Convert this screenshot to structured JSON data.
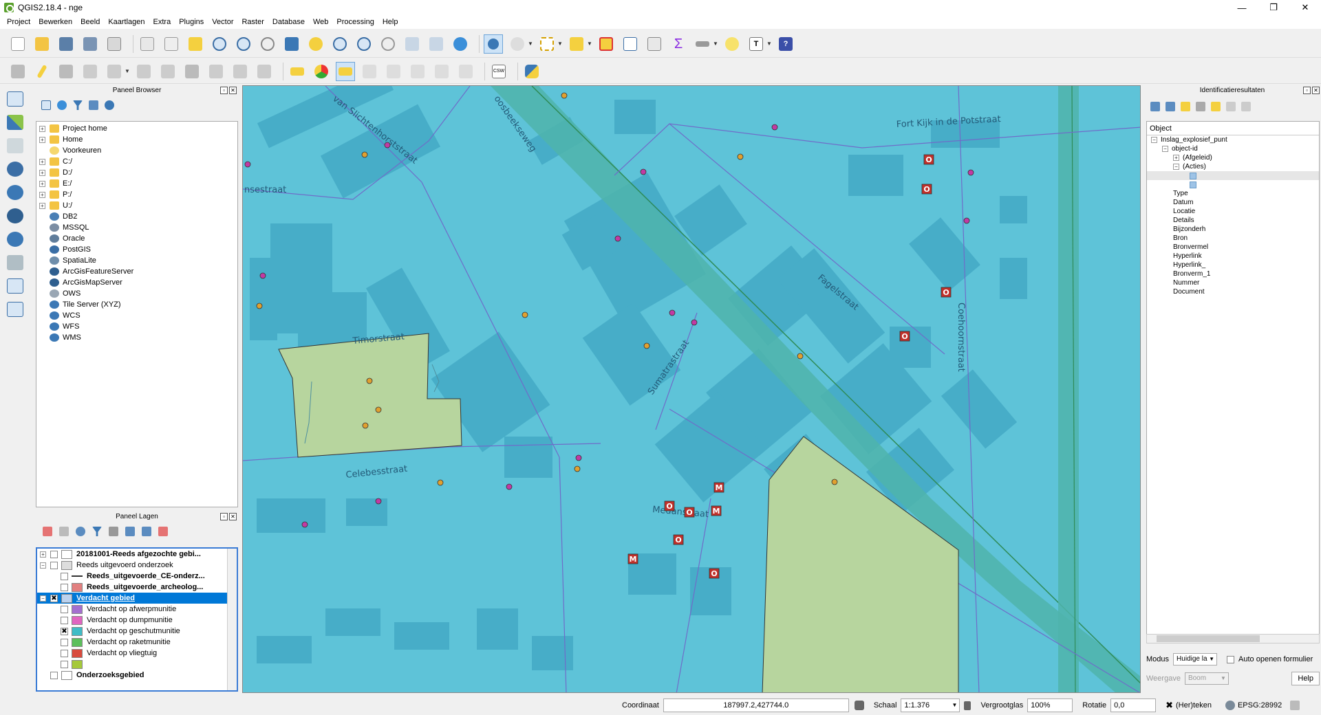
{
  "window": {
    "title": "QGIS2.18.4 - nge",
    "minimize": "—",
    "maximize": "❐",
    "close": "✕"
  },
  "menu": [
    "Project",
    "Bewerken",
    "Beeld",
    "Kaartlagen",
    "Extra",
    "Plugins",
    "Vector",
    "Raster",
    "Database",
    "Web",
    "Processing",
    "Help"
  ],
  "browser_panel": {
    "title": "Paneel Browser",
    "items": [
      {
        "label": "Project home",
        "expandable": true,
        "icon": "folder-icon",
        "color": "#f3c443"
      },
      {
        "label": "Home",
        "expandable": true,
        "icon": "folder-icon",
        "color": "#f3c443"
      },
      {
        "label": "Voorkeuren",
        "expandable": false,
        "icon": "star-icon",
        "color": "#f5d76e"
      },
      {
        "label": "C:/",
        "expandable": true,
        "icon": "folder-icon",
        "color": "#f3c443"
      },
      {
        "label": "D:/",
        "expandable": true,
        "icon": "folder-icon",
        "color": "#f3c443"
      },
      {
        "label": "E:/",
        "expandable": true,
        "icon": "folder-icon",
        "color": "#f3c443"
      },
      {
        "label": "P:/",
        "expandable": true,
        "icon": "folder-icon",
        "color": "#f3c443"
      },
      {
        "label": "U:/",
        "expandable": true,
        "icon": "folder-icon",
        "color": "#f3c443"
      },
      {
        "label": "DB2",
        "expandable": false,
        "icon": "db2-icon",
        "color": "#4a7fb5"
      },
      {
        "label": "MSSQL",
        "expandable": false,
        "icon": "mssql-icon",
        "color": "#7b8da3"
      },
      {
        "label": "Oracle",
        "expandable": false,
        "icon": "oracle-icon",
        "color": "#607d9b"
      },
      {
        "label": "PostGIS",
        "expandable": false,
        "icon": "postgis-icon",
        "color": "#3a6ea5"
      },
      {
        "label": "SpatiaLite",
        "expandable": false,
        "icon": "spatialite-icon",
        "color": "#6f8eab"
      },
      {
        "label": "ArcGisFeatureServer",
        "expandable": false,
        "icon": "arcgis-feature-icon",
        "color": "#2f5f8f"
      },
      {
        "label": "ArcGisMapServer",
        "expandable": false,
        "icon": "arcgis-map-icon",
        "color": "#2f5f8f"
      },
      {
        "label": "OWS",
        "expandable": false,
        "icon": "ows-icon",
        "color": "#9aa7b4"
      },
      {
        "label": "Tile Server (XYZ)",
        "expandable": false,
        "icon": "tile-server-icon",
        "color": "#3b78b5"
      },
      {
        "label": "WCS",
        "expandable": false,
        "icon": "wcs-icon",
        "color": "#3b78b5"
      },
      {
        "label": "WFS",
        "expandable": false,
        "icon": "wfs-icon",
        "color": "#3b78b5"
      },
      {
        "label": "WMS",
        "expandable": false,
        "icon": "wms-icon",
        "color": "#3b78b5"
      }
    ]
  },
  "layers_panel": {
    "title": "Paneel Lagen",
    "rows": [
      {
        "label": "20181001-Reeds afgezochte gebi...",
        "indent": 0,
        "bold": true,
        "checked": false,
        "expand": "+",
        "swatch": "#ffffff",
        "selected": false
      },
      {
        "label": "Reeds uitgevoerd onderzoek",
        "indent": 0,
        "bold": false,
        "checked": false,
        "expand": "−",
        "swatch": "#dddddd",
        "selected": false
      },
      {
        "label": "Reeds_uitgevoerde_CE-onderz...",
        "indent": 1,
        "bold": true,
        "checked": false,
        "expand": "",
        "swatch": "#333333",
        "selected": false
      },
      {
        "label": "Reeds_uitgevoerde_archeolog...",
        "indent": 1,
        "bold": true,
        "checked": false,
        "expand": "",
        "swatch": "#e28080",
        "selected": false
      },
      {
        "label": "Verdacht gebied",
        "indent": 0,
        "bold": true,
        "checked": true,
        "expand": "−",
        "swatch": "#bcd2ee",
        "selected": true
      },
      {
        "label": "Verdacht op afwerpmunitie",
        "indent": 1,
        "bold": false,
        "checked": false,
        "expand": "",
        "swatch": "#a46fcf",
        "selected": false
      },
      {
        "label": "Verdacht op dumpmunitie",
        "indent": 1,
        "bold": false,
        "checked": false,
        "expand": "",
        "swatch": "#e065c0",
        "selected": false
      },
      {
        "label": "Verdacht op geschutmunitie",
        "indent": 1,
        "bold": false,
        "checked": true,
        "expand": "",
        "swatch": "#3fbcc6",
        "selected": false
      },
      {
        "label": "Verdacht op raketmunitie",
        "indent": 1,
        "bold": false,
        "checked": false,
        "expand": "",
        "swatch": "#5cbf5c",
        "selected": false
      },
      {
        "label": "Verdacht op vliegtuig",
        "indent": 1,
        "bold": false,
        "checked": false,
        "expand": "",
        "swatch": "#d84a3d",
        "selected": false
      },
      {
        "label": "",
        "indent": 1,
        "bold": false,
        "checked": false,
        "expand": "",
        "swatch": "#a5c93a",
        "selected": false
      },
      {
        "label": "Onderzoeksgebied",
        "indent": 0,
        "bold": true,
        "checked": false,
        "expand": "",
        "swatch": "#ffffff",
        "selected": false
      }
    ]
  },
  "map": {
    "streets": [
      "van Slichtenhorststraat",
      "Fort Kijk in de Potstraat",
      "Fagelstraat",
      "Coehoornstraat",
      "Timorstraat",
      "Sumatrastraat",
      "Celebesstraat",
      "Medanstraat",
      "nsestraat",
      "oosbeekseweg"
    ],
    "marker_letters": {
      "o": "O",
      "m": "M"
    }
  },
  "identify_panel": {
    "title": "Identificatieresultaten",
    "header": "Object",
    "tree": [
      {
        "label": "Inslag_explosief_punt",
        "indent": 0,
        "expand": "−"
      },
      {
        "label": "object-id",
        "indent": 1,
        "expand": "−"
      },
      {
        "label": "(Afgeleid)",
        "indent": 2,
        "expand": "+"
      },
      {
        "label": "(Acties)",
        "indent": 2,
        "expand": "−"
      },
      {
        "label": "",
        "indent": 3,
        "expand": "",
        "highlight": true
      },
      {
        "label": "",
        "indent": 3,
        "expand": ""
      },
      {
        "label": "Type",
        "indent": 2,
        "expand": ""
      },
      {
        "label": "Datum",
        "indent": 2,
        "expand": ""
      },
      {
        "label": "Locatie",
        "indent": 2,
        "expand": ""
      },
      {
        "label": "Details",
        "indent": 2,
        "expand": ""
      },
      {
        "label": "Bijzonderh",
        "indent": 2,
        "expand": ""
      },
      {
        "label": "Bron",
        "indent": 2,
        "expand": ""
      },
      {
        "label": "Bronvermel",
        "indent": 2,
        "expand": ""
      },
      {
        "label": "Hyperlink",
        "indent": 2,
        "expand": ""
      },
      {
        "label": "Hyperlink_",
        "indent": 2,
        "expand": ""
      },
      {
        "label": "Bronverm_1",
        "indent": 2,
        "expand": ""
      },
      {
        "label": "Nummer",
        "indent": 2,
        "expand": ""
      },
      {
        "label": "Document",
        "indent": 2,
        "expand": ""
      }
    ],
    "mode_label": "Modus",
    "mode_value": "Huidige la",
    "auto_open_label": "Auto openen formulier",
    "view_label": "Weergave",
    "view_value": "Boom",
    "help_label": "Help"
  },
  "status": {
    "coord_label": "Coordinaat",
    "coord_value": "187997.2,427744.0",
    "scale_label": "Schaal",
    "scale_value": "1:1.376",
    "magnifier_label": "Vergrootglas",
    "magnifier_value": "100%",
    "rotation_label": "Rotatie",
    "rotation_value": "0,0",
    "render_label": "(Her)teken",
    "crs_label": "EPSG:28992"
  }
}
